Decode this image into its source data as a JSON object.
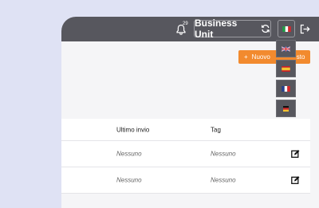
{
  "header": {
    "notification_count": "29",
    "business_unit_label": "Business Unit"
  },
  "languages": {
    "current": "it",
    "options": [
      "en",
      "es",
      "fr",
      "de"
    ]
  },
  "actions": {
    "new_label": "Nuovo",
    "new_label_hidden_suffix": "sto"
  },
  "table": {
    "columns": [
      "Ultimo invio",
      "Tag"
    ],
    "rows": [
      [
        "Nessuno",
        "Nessuno"
      ],
      [
        "Nessuno",
        "Nessuno"
      ]
    ]
  },
  "colors": {
    "topbar": "#57575e",
    "accent": "#f28a2e",
    "background": "#dfe2f4"
  }
}
